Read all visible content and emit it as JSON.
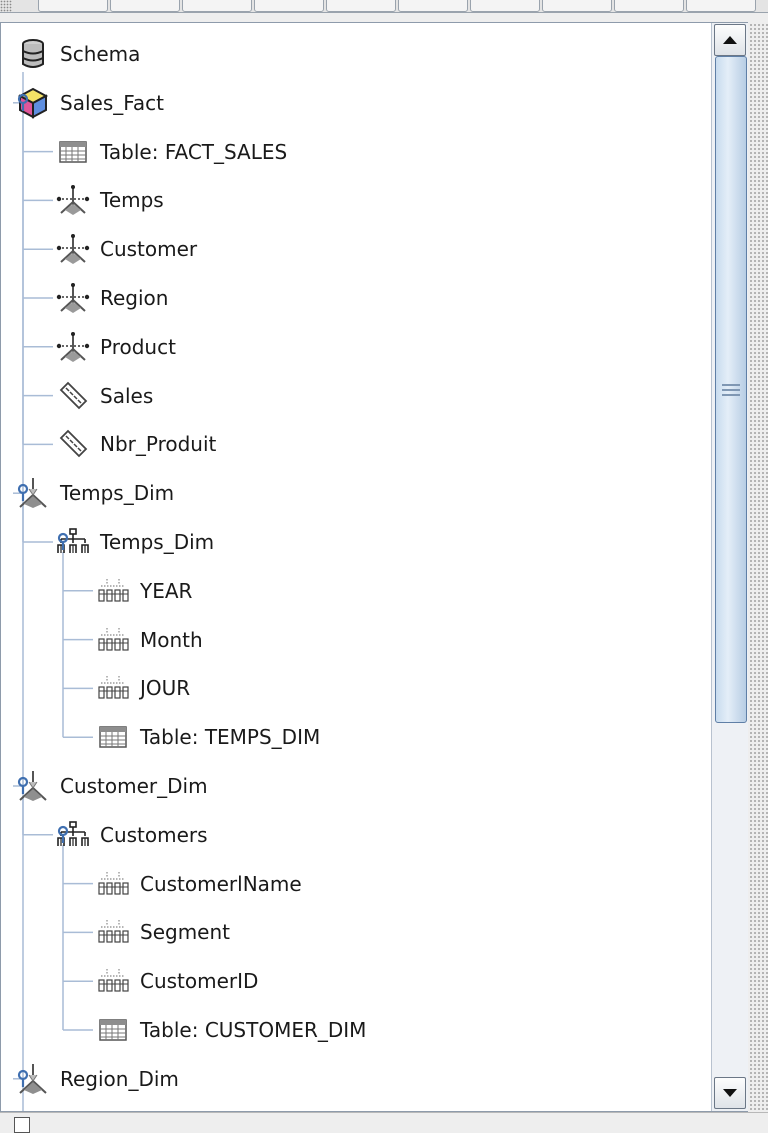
{
  "tree": {
    "items": [
      {
        "label": "Schema",
        "icon": "database-icon",
        "level": 0,
        "handle": false
      },
      {
        "label": "Sales_Fact",
        "icon": "cube-icon",
        "level": 0,
        "handle": true
      },
      {
        "label": "Table: FACT_SALES",
        "icon": "table-icon",
        "level": 1,
        "handle": false
      },
      {
        "label": "Temps",
        "icon": "dimension-usage-icon",
        "level": 1,
        "handle": false
      },
      {
        "label": "Customer",
        "icon": "dimension-usage-icon",
        "level": 1,
        "handle": false
      },
      {
        "label": "Region",
        "icon": "dimension-usage-icon",
        "level": 1,
        "handle": false
      },
      {
        "label": "Product",
        "icon": "dimension-usage-icon",
        "level": 1,
        "handle": false
      },
      {
        "label": "Sales",
        "icon": "measure-icon",
        "level": 1,
        "handle": false
      },
      {
        "label": "Nbr_Produit",
        "icon": "measure-icon",
        "level": 1,
        "handle": false
      },
      {
        "label": "Temps_Dim",
        "icon": "dimension-icon",
        "level": 0,
        "handle": true
      },
      {
        "label": "Temps_Dim",
        "icon": "hierarchy-icon",
        "level": 1,
        "handle": true
      },
      {
        "label": "YEAR",
        "icon": "level-icon",
        "level": 2,
        "handle": false
      },
      {
        "label": "Month",
        "icon": "level-icon",
        "level": 2,
        "handle": false
      },
      {
        "label": "JOUR",
        "icon": "level-icon",
        "level": 2,
        "handle": false
      },
      {
        "label": "Table: TEMPS_DIM",
        "icon": "table-icon",
        "level": 2,
        "handle": false
      },
      {
        "label": "Customer_Dim",
        "icon": "dimension-icon",
        "level": 0,
        "handle": true
      },
      {
        "label": "Customers",
        "icon": "hierarchy-icon",
        "level": 1,
        "handle": true
      },
      {
        "label": "CustomerlName",
        "icon": "level-icon",
        "level": 2,
        "handle": false
      },
      {
        "label": "Segment",
        "icon": "level-icon",
        "level": 2,
        "handle": false
      },
      {
        "label": "CustomerID",
        "icon": "level-icon",
        "level": 2,
        "handle": false
      },
      {
        "label": "Table: CUSTOMER_DIM",
        "icon": "table-icon",
        "level": 2,
        "handle": false
      },
      {
        "label": "Region_Dim",
        "icon": "dimension-icon",
        "level": 0,
        "handle": true
      }
    ]
  },
  "scrollbar": {
    "position": 0.0,
    "visible_fraction": 0.62
  },
  "colors": {
    "guide": "#a9bcd6",
    "handle": "#3f6fb0",
    "text": "#1a1a1a",
    "thumb_border": "#5f7fa6"
  }
}
